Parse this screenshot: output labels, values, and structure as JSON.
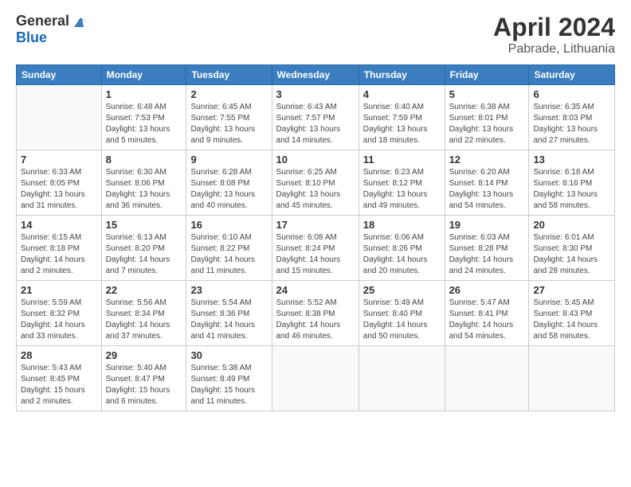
{
  "header": {
    "logo_general": "General",
    "logo_blue": "Blue",
    "title": "April 2024",
    "location": "Pabrade, Lithuania"
  },
  "days_of_week": [
    "Sunday",
    "Monday",
    "Tuesday",
    "Wednesday",
    "Thursday",
    "Friday",
    "Saturday"
  ],
  "weeks": [
    [
      {
        "day": "",
        "sunrise": "",
        "sunset": "",
        "daylight": ""
      },
      {
        "day": "1",
        "sunrise": "Sunrise: 6:48 AM",
        "sunset": "Sunset: 7:53 PM",
        "daylight": "Daylight: 13 hours and 5 minutes."
      },
      {
        "day": "2",
        "sunrise": "Sunrise: 6:45 AM",
        "sunset": "Sunset: 7:55 PM",
        "daylight": "Daylight: 13 hours and 9 minutes."
      },
      {
        "day": "3",
        "sunrise": "Sunrise: 6:43 AM",
        "sunset": "Sunset: 7:57 PM",
        "daylight": "Daylight: 13 hours and 14 minutes."
      },
      {
        "day": "4",
        "sunrise": "Sunrise: 6:40 AM",
        "sunset": "Sunset: 7:59 PM",
        "daylight": "Daylight: 13 hours and 18 minutes."
      },
      {
        "day": "5",
        "sunrise": "Sunrise: 6:38 AM",
        "sunset": "Sunset: 8:01 PM",
        "daylight": "Daylight: 13 hours and 22 minutes."
      },
      {
        "day": "6",
        "sunrise": "Sunrise: 6:35 AM",
        "sunset": "Sunset: 8:03 PM",
        "daylight": "Daylight: 13 hours and 27 minutes."
      }
    ],
    [
      {
        "day": "7",
        "sunrise": "Sunrise: 6:33 AM",
        "sunset": "Sunset: 8:05 PM",
        "daylight": "Daylight: 13 hours and 31 minutes."
      },
      {
        "day": "8",
        "sunrise": "Sunrise: 6:30 AM",
        "sunset": "Sunset: 8:06 PM",
        "daylight": "Daylight: 13 hours and 36 minutes."
      },
      {
        "day": "9",
        "sunrise": "Sunrise: 6:28 AM",
        "sunset": "Sunset: 8:08 PM",
        "daylight": "Daylight: 13 hours and 40 minutes."
      },
      {
        "day": "10",
        "sunrise": "Sunrise: 6:25 AM",
        "sunset": "Sunset: 8:10 PM",
        "daylight": "Daylight: 13 hours and 45 minutes."
      },
      {
        "day": "11",
        "sunrise": "Sunrise: 6:23 AM",
        "sunset": "Sunset: 8:12 PM",
        "daylight": "Daylight: 13 hours and 49 minutes."
      },
      {
        "day": "12",
        "sunrise": "Sunrise: 6:20 AM",
        "sunset": "Sunset: 8:14 PM",
        "daylight": "Daylight: 13 hours and 54 minutes."
      },
      {
        "day": "13",
        "sunrise": "Sunrise: 6:18 AM",
        "sunset": "Sunset: 8:16 PM",
        "daylight": "Daylight: 13 hours and 58 minutes."
      }
    ],
    [
      {
        "day": "14",
        "sunrise": "Sunrise: 6:15 AM",
        "sunset": "Sunset: 8:18 PM",
        "daylight": "Daylight: 14 hours and 2 minutes."
      },
      {
        "day": "15",
        "sunrise": "Sunrise: 6:13 AM",
        "sunset": "Sunset: 8:20 PM",
        "daylight": "Daylight: 14 hours and 7 minutes."
      },
      {
        "day": "16",
        "sunrise": "Sunrise: 6:10 AM",
        "sunset": "Sunset: 8:22 PM",
        "daylight": "Daylight: 14 hours and 11 minutes."
      },
      {
        "day": "17",
        "sunrise": "Sunrise: 6:08 AM",
        "sunset": "Sunset: 8:24 PM",
        "daylight": "Daylight: 14 hours and 15 minutes."
      },
      {
        "day": "18",
        "sunrise": "Sunrise: 6:06 AM",
        "sunset": "Sunset: 8:26 PM",
        "daylight": "Daylight: 14 hours and 20 minutes."
      },
      {
        "day": "19",
        "sunrise": "Sunrise: 6:03 AM",
        "sunset": "Sunset: 8:28 PM",
        "daylight": "Daylight: 14 hours and 24 minutes."
      },
      {
        "day": "20",
        "sunrise": "Sunrise: 6:01 AM",
        "sunset": "Sunset: 8:30 PM",
        "daylight": "Daylight: 14 hours and 28 minutes."
      }
    ],
    [
      {
        "day": "21",
        "sunrise": "Sunrise: 5:59 AM",
        "sunset": "Sunset: 8:32 PM",
        "daylight": "Daylight: 14 hours and 33 minutes."
      },
      {
        "day": "22",
        "sunrise": "Sunrise: 5:56 AM",
        "sunset": "Sunset: 8:34 PM",
        "daylight": "Daylight: 14 hours and 37 minutes."
      },
      {
        "day": "23",
        "sunrise": "Sunrise: 5:54 AM",
        "sunset": "Sunset: 8:36 PM",
        "daylight": "Daylight: 14 hours and 41 minutes."
      },
      {
        "day": "24",
        "sunrise": "Sunrise: 5:52 AM",
        "sunset": "Sunset: 8:38 PM",
        "daylight": "Daylight: 14 hours and 46 minutes."
      },
      {
        "day": "25",
        "sunrise": "Sunrise: 5:49 AM",
        "sunset": "Sunset: 8:40 PM",
        "daylight": "Daylight: 14 hours and 50 minutes."
      },
      {
        "day": "26",
        "sunrise": "Sunrise: 5:47 AM",
        "sunset": "Sunset: 8:41 PM",
        "daylight": "Daylight: 14 hours and 54 minutes."
      },
      {
        "day": "27",
        "sunrise": "Sunrise: 5:45 AM",
        "sunset": "Sunset: 8:43 PM",
        "daylight": "Daylight: 14 hours and 58 minutes."
      }
    ],
    [
      {
        "day": "28",
        "sunrise": "Sunrise: 5:43 AM",
        "sunset": "Sunset: 8:45 PM",
        "daylight": "Daylight: 15 hours and 2 minutes."
      },
      {
        "day": "29",
        "sunrise": "Sunrise: 5:40 AM",
        "sunset": "Sunset: 8:47 PM",
        "daylight": "Daylight: 15 hours and 6 minutes."
      },
      {
        "day": "30",
        "sunrise": "Sunrise: 5:38 AM",
        "sunset": "Sunset: 8:49 PM",
        "daylight": "Daylight: 15 hours and 11 minutes."
      },
      {
        "day": "",
        "sunrise": "",
        "sunset": "",
        "daylight": ""
      },
      {
        "day": "",
        "sunrise": "",
        "sunset": "",
        "daylight": ""
      },
      {
        "day": "",
        "sunrise": "",
        "sunset": "",
        "daylight": ""
      },
      {
        "day": "",
        "sunrise": "",
        "sunset": "",
        "daylight": ""
      }
    ]
  ]
}
